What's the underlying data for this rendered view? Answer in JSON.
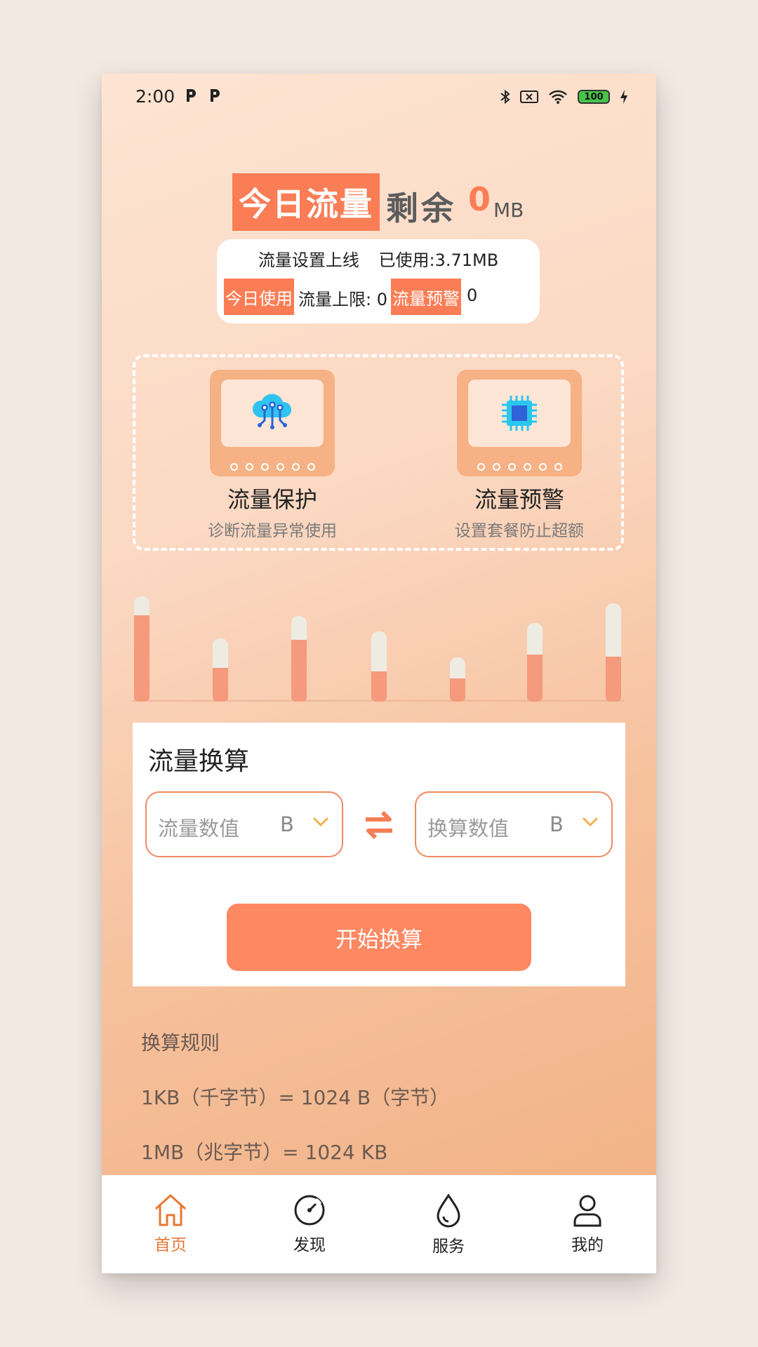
{
  "status_bar": {
    "time": "2:00",
    "battery": "100"
  },
  "hero": {
    "tag": "今日流量",
    "remain_label": "剩余",
    "remain_value": "0",
    "remain_unit": "MB"
  },
  "info": {
    "line1_left": "流量设置上线",
    "line1_right": "已使用:3.71MB",
    "chip_today": "今日使用",
    "limit_text": "流量上限: 0",
    "chip_warning": "流量预警",
    "warning_value": "0"
  },
  "features": [
    {
      "title": "流量保护",
      "subtitle": "诊断流量异常使用",
      "icon": "cloud-network-icon"
    },
    {
      "title": "流量预警",
      "subtitle": "设置套餐防止超额",
      "icon": "chip-icon"
    }
  ],
  "usage_bars": [
    0.82,
    0.53,
    0.72,
    0.43,
    0.52,
    0.6,
    0.46
  ],
  "converter": {
    "title": "流量换算",
    "input_placeholder": "流量数值",
    "input_unit": "B",
    "output_placeholder": "换算数值",
    "output_unit": "B",
    "button": "开始换算"
  },
  "rules": {
    "title": "换算规则",
    "items": [
      "1KB（千字节）= 1024 B（字节）",
      "1MB（兆字节）= 1024 KB"
    ]
  },
  "tabbar": {
    "items": [
      {
        "label": "首页",
        "icon": "home-icon",
        "active": true
      },
      {
        "label": "发现",
        "icon": "compass-icon",
        "active": false
      },
      {
        "label": "服务",
        "icon": "drop-icon",
        "active": false
      },
      {
        "label": "我的",
        "icon": "user-icon",
        "active": false
      }
    ]
  },
  "colors": {
    "accent": "#fb7d55",
    "active_tab": "#e87634"
  }
}
